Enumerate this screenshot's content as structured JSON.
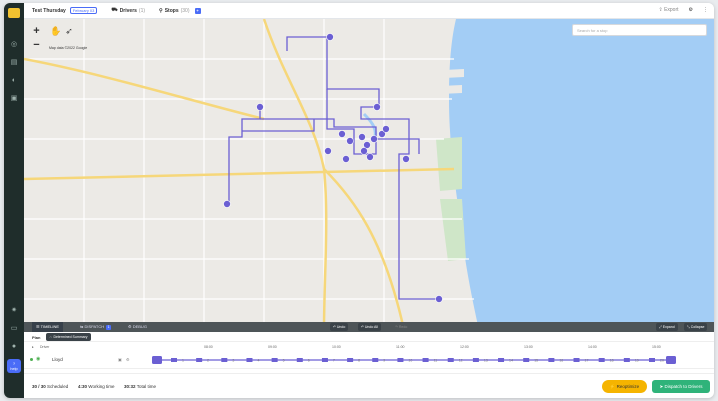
{
  "header": {
    "title": "Test Thursday",
    "date_chip": "February 03",
    "drivers_label": "Drivers",
    "drivers_count": "(1)",
    "stops_label": "Stops",
    "stops_count": "(30)",
    "stops_badge": "+",
    "export_label": "Export"
  },
  "map": {
    "zoom_in": "+",
    "zoom_out": "−",
    "copyright": "Map data ©2022 Google",
    "search_placeholder": "Search for a stop",
    "stop_count": 30
  },
  "tabs": {
    "timeline": "TIMELINE",
    "dispatch": "DISPATCH",
    "dispatch_badge": "1",
    "debug": "DEBUG"
  },
  "controls": {
    "undo": "Undo",
    "undo_all": "Undo All",
    "redo": "Redo",
    "expand": "Expand",
    "collapse": "Collapse"
  },
  "plan": {
    "label": "Plan",
    "summary_button": "Determined Summary"
  },
  "timeline_header": {
    "columns": [
      "Driver",
      "08:00",
      "09:00",
      "10:00",
      "11:00",
      "12:00",
      "13:00",
      "14:00",
      "15:00",
      "16:00"
    ]
  },
  "driver": {
    "name": "Lloyd",
    "stop_numbers": [
      "1",
      "2",
      "3",
      "4",
      "5",
      "6",
      "7",
      "8",
      "9",
      "10",
      "11",
      "12",
      "13",
      "14",
      "15",
      "16",
      "17",
      "18",
      "19",
      "20"
    ]
  },
  "footer": {
    "scheduled": "30 / 30",
    "scheduled_label": "Scheduled",
    "working_time": "4:30",
    "working_time_label": "Working time",
    "total_time": "30:32",
    "total_time_label": "Total time",
    "reoptimize": "Reoptimize",
    "dispatch": "Dispatch to Drivers"
  },
  "colors": {
    "route": "#6b5fd3",
    "water": "#a3cdf5",
    "rail": "#1f2d2b",
    "reoptimize": "#f5b400",
    "dispatch": "#2fb37a",
    "accent": "#4a6cf7"
  }
}
